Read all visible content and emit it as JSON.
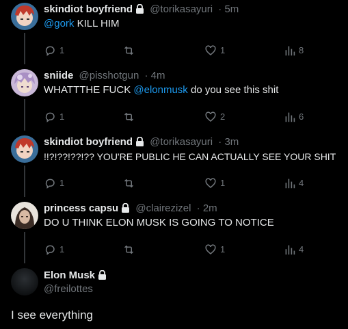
{
  "tweets": [
    {
      "name": "skindiot boyfriend",
      "handle": "@torikasayuri",
      "time": "· 5m",
      "mention": "@gork",
      "text_before": "",
      "text_after": " KILL HIM",
      "replies": "1",
      "likes": "1",
      "views": "8"
    },
    {
      "name": "sniide",
      "handle": "@pisshotgun",
      "time": "· 4m",
      "mention": "@elonmusk",
      "text_before": "WHATTTHE FUCK ",
      "text_after": " do you see this shit",
      "replies": "1",
      "likes": "2",
      "views": "6"
    },
    {
      "name": "skindiot boyfriend",
      "handle": "@torikasayuri",
      "time": "· 3m",
      "mention": "",
      "text_before": "!!?!??!??!?? YOU'RE PUBLIC HE CAN ACTUALLY SEE YOUR SHIT",
      "text_after": "",
      "replies": "1",
      "likes": "1",
      "views": "4"
    },
    {
      "name": "princess capsu",
      "handle": "@clairezizel",
      "time": "· 2m",
      "mention": "",
      "text_before": "DO U THINK ELON MUSK IS GOING TO NOTICE",
      "text_after": "",
      "replies": "1",
      "likes": "1",
      "views": "4"
    }
  ],
  "main_post": {
    "name": "Elon Musk",
    "handle": "@freilottes",
    "text": "I see everything"
  },
  "colors": {
    "background": "#000000",
    "text": "#e7e9ea",
    "muted": "#71767b",
    "mention": "#1d9bf0",
    "thread_line": "#333639"
  },
  "icons": [
    "lock-icon",
    "reply-icon",
    "retweet-icon",
    "like-icon",
    "views-icon"
  ]
}
